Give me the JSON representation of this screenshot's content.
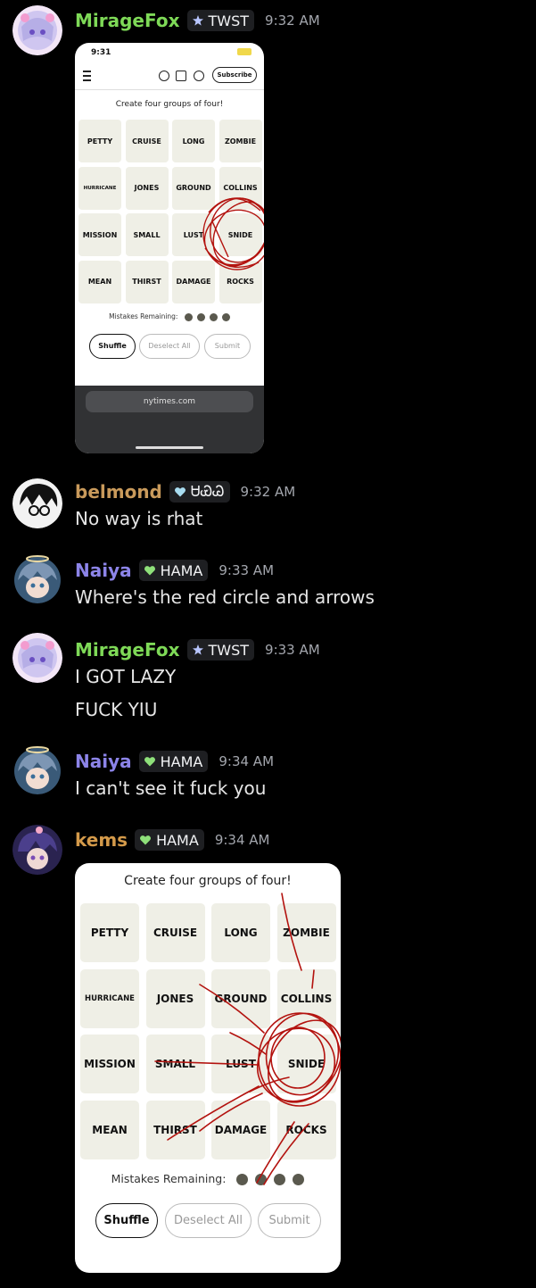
{
  "colors": {
    "background": "#000000",
    "mirage_name": "#7ed957",
    "belmond_name": "#c99a5b",
    "naiya_name": "#8c84e8",
    "kems_name": "#d49a4a",
    "tag_bg": "#1e1f22",
    "timestamp": "#a3a6ad",
    "tile": "#efefe6",
    "scribble": "#b3120e"
  },
  "messages": [
    {
      "username": "MirageFox",
      "tag_icon": "star-icon",
      "tag": "TWST",
      "time": "9:32 AM"
    },
    {
      "username": "belmond",
      "tag_icon": "heart-icon",
      "tag": "ᏌᏯᏊ",
      "time": "9:32 AM",
      "lines": [
        "No way is rhat"
      ]
    },
    {
      "username": "Naiya",
      "tag_icon": "heart-icon",
      "tag": "HAMA",
      "time": "9:33 AM",
      "lines": [
        "Where's the red circle and arrows"
      ]
    },
    {
      "username": "MirageFox",
      "tag_icon": "star-icon",
      "tag": "TWST",
      "time": "9:33 AM",
      "lines": [
        "I GOT LAZY",
        "FUCK YIU"
      ]
    },
    {
      "username": "Naiya",
      "tag_icon": "heart-icon",
      "tag": "HAMA",
      "time": "9:34 AM",
      "lines": [
        "I can't see it fuck you"
      ]
    },
    {
      "username": "kems",
      "tag_icon": "heart-icon",
      "tag": "HAMA",
      "time": "9:34 AM"
    }
  ],
  "shot1": {
    "status_time": "9:31",
    "subscribe": "Subscribe",
    "url": "nytimes.com"
  },
  "game": {
    "title": "Create four groups of four!",
    "tiles": [
      "PETTY",
      "CRUISE",
      "LONG",
      "ZOMBIE",
      "HURRICANE",
      "JONES",
      "GROUND",
      "COLLINS",
      "MISSION",
      "SMALL",
      "LUST",
      "SNIDE",
      "MEAN",
      "THIRST",
      "DAMAGE",
      "ROCKS"
    ],
    "mistakes_label": "Mistakes Remaining:",
    "mistakes_remaining": 4,
    "shuffle": "Shuffle",
    "deselect": "Deselect All",
    "submit": "Submit"
  }
}
